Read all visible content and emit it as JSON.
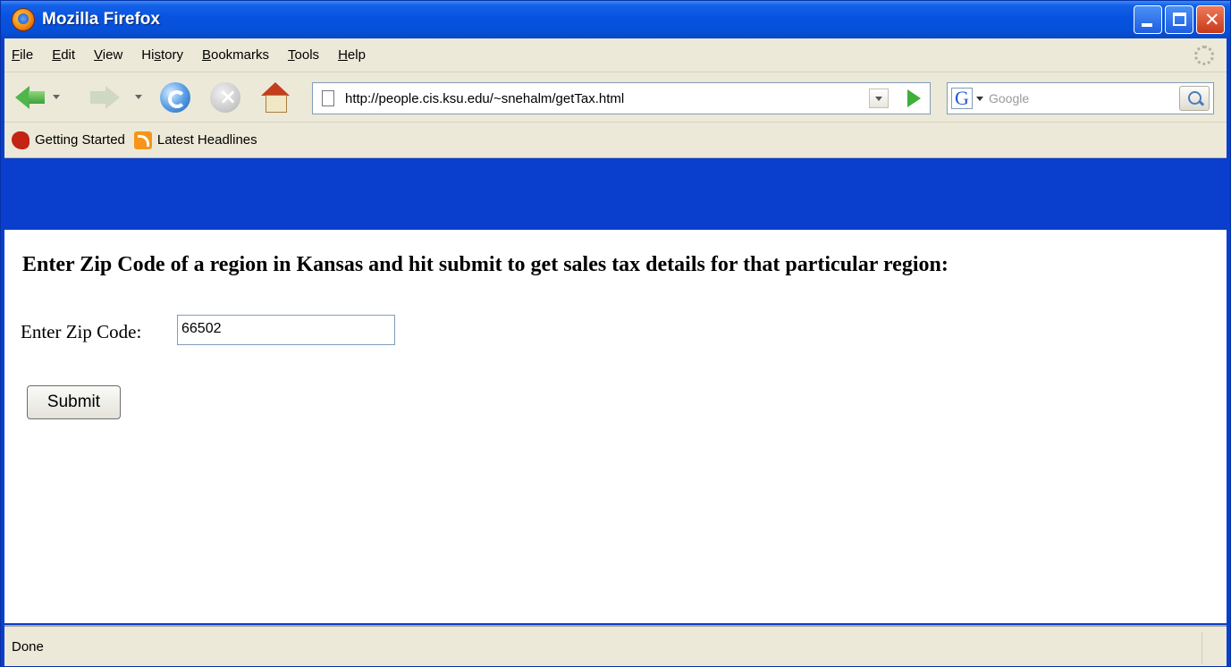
{
  "window": {
    "title": "Mozilla Firefox"
  },
  "menubar": {
    "items": [
      {
        "label": "File",
        "key": "F",
        "rest": "ile"
      },
      {
        "label": "Edit",
        "key": "E",
        "rest": "dit"
      },
      {
        "label": "View",
        "key": "V",
        "rest": "iew"
      },
      {
        "label": "History",
        "pre": "Hi",
        "key": "s",
        "rest": "tory"
      },
      {
        "label": "Bookmarks",
        "key": "B",
        "rest": "ookmarks"
      },
      {
        "label": "Tools",
        "key": "T",
        "rest": "ools"
      },
      {
        "label": "Help",
        "key": "H",
        "rest": "elp"
      }
    ]
  },
  "navbar": {
    "url": "http://people.cis.ksu.edu/~snehalm/getTax.html",
    "search_placeholder": "Google",
    "search_engine_letter": "G"
  },
  "bookmarks": {
    "items": [
      {
        "label": "Getting Started",
        "icon": "firefox-getting-started-icon"
      },
      {
        "label": "Latest Headlines",
        "icon": "rss-feed-icon"
      }
    ]
  },
  "page": {
    "heading": "Enter Zip Code of a region in Kansas and hit submit to get sales tax details for that particular region:",
    "zip_label": "Enter Zip Code:",
    "zip_value": "66502",
    "submit_label": "Submit"
  },
  "status": {
    "text": "Done"
  }
}
